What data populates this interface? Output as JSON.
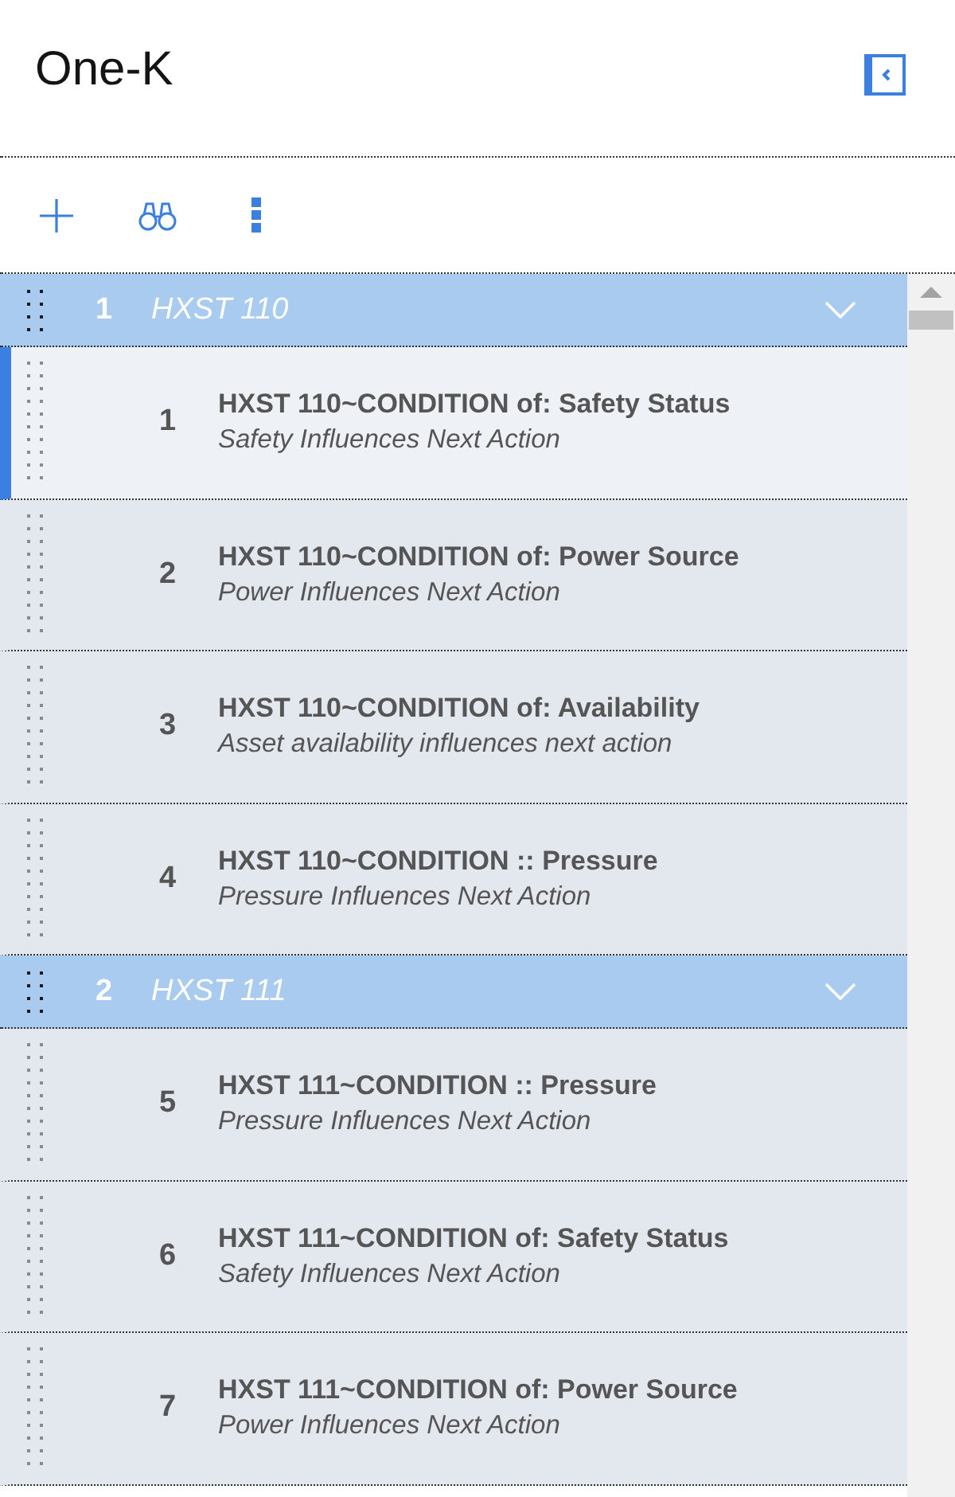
{
  "header": {
    "title": "One-K"
  },
  "groups": [
    {
      "number": "1",
      "name": "HXST 110",
      "expanded": true,
      "items": [
        {
          "number": "1",
          "title": "HXST 110~CONDITION of: Safety Status",
          "subtitle": "Safety Influences Next Action",
          "selected": true
        },
        {
          "number": "2",
          "title": "HXST 110~CONDITION of: Power Source",
          "subtitle": "Power Influences Next Action",
          "selected": false
        },
        {
          "number": "3",
          "title": "HXST 110~CONDITION of: Availability",
          "subtitle": "Asset availability influences next action",
          "selected": false
        },
        {
          "number": "4",
          "title": "HXST 110~CONDITION :: Pressure",
          "subtitle": "Pressure Influences Next Action",
          "selected": false
        }
      ]
    },
    {
      "number": "2",
      "name": "HXST 111",
      "expanded": true,
      "items": [
        {
          "number": "5",
          "title": "HXST 111~CONDITION :: Pressure",
          "subtitle": "Pressure Influences Next Action",
          "selected": false
        },
        {
          "number": "6",
          "title": "HXST 111~CONDITION of: Safety Status",
          "subtitle": "Safety Influences Next Action",
          "selected": false
        },
        {
          "number": "7",
          "title": "HXST 111~CONDITION of: Power Source",
          "subtitle": "Power Influences Next Action",
          "selected": false
        }
      ]
    }
  ]
}
